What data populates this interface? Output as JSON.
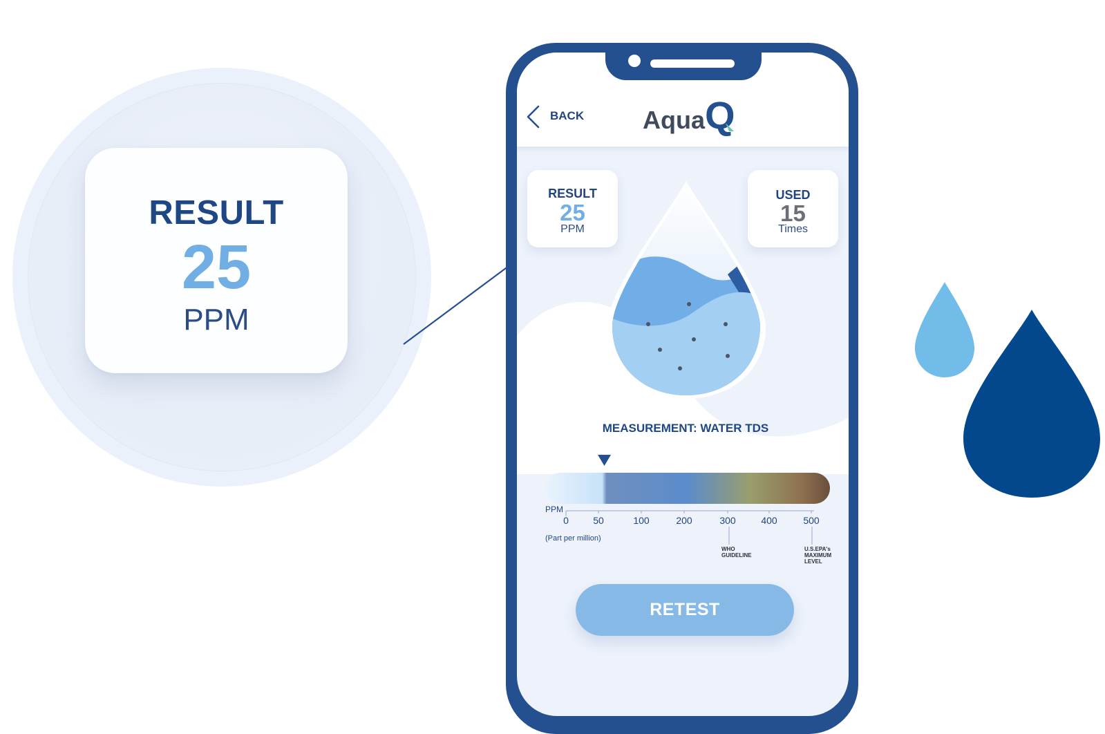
{
  "zoom": {
    "title": "RESULT",
    "value": "25",
    "unit": "PPM"
  },
  "app": {
    "brand_text": "Aqua",
    "brand_mark": "Q",
    "back_label": "BACK"
  },
  "result_card": {
    "title": "RESULT",
    "value": "25",
    "unit": "PPM"
  },
  "used_card": {
    "title": "USED",
    "value": "15",
    "unit": "Times"
  },
  "measurement": {
    "title": "MEASUREMENT: WATER TDS",
    "unit_label": "PPM",
    "unit_note": "(Part per million)",
    "ticks": [
      "0",
      "50",
      "100",
      "200",
      "300",
      "400",
      "500"
    ],
    "current_value": 50,
    "who_label": [
      "WHO",
      "GUIDELINE"
    ],
    "epa_label": [
      "U.S.EPA's",
      "MAXIMUM",
      "LEVEL"
    ]
  },
  "retest_label": "RETEST",
  "colors": {
    "navy": "#24508f",
    "text_blue": "#22457f",
    "value_blue": "#70aee3",
    "button": "#86b9e6",
    "drop_light": "#72bcea",
    "drop_dark": "#03488d",
    "logo_teal": "#6ec4b5"
  },
  "icons": {
    "back": "chevron-left-icon",
    "indicator": "triangle-down-icon"
  }
}
